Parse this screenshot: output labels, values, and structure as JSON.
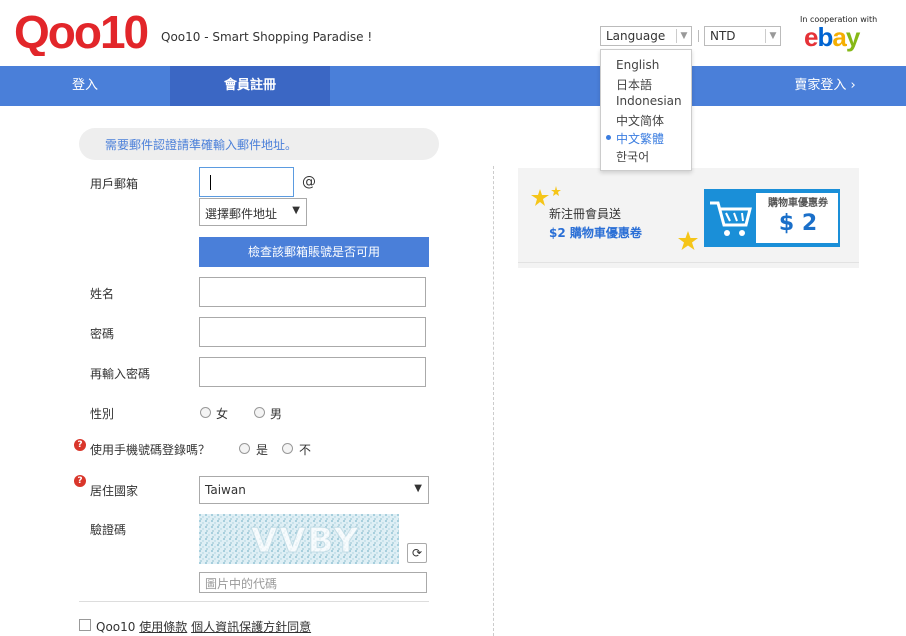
{
  "header": {
    "logo_text": "Qoo10",
    "tagline": "Qoo10 - Smart Shopping Paradise !",
    "language_label": "Language",
    "currency_label": "NTD",
    "coop_label": "In cooperation with",
    "partner_logo": "ebay"
  },
  "nav": {
    "login": "登入",
    "register": "會員註冊",
    "seller_login": "賣家登入 ›"
  },
  "language_menu": {
    "items": [
      "English",
      "日本語",
      "Indonesian",
      "中文简体",
      "中文繁體",
      "한국어"
    ],
    "selected": "中文繁體"
  },
  "notice": "需要郵件認證請準確輸入郵件地址。",
  "form": {
    "email_label": "用戶郵箱",
    "email_value": "",
    "at_sign": "@",
    "domain_select": "選擇郵件地址",
    "check_button": "檢查該郵箱賬號是否可用",
    "name_label": "姓名",
    "password_label": "密碼",
    "password_confirm_label": "再輸入密碼",
    "gender_label": "性別",
    "gender_female": "女",
    "gender_male": "男",
    "mobile_question": "使用手機號碼登錄嗎？",
    "mobile_yes": "是",
    "mobile_no": "不",
    "country_label": "居住國家",
    "country_value": "Taiwan",
    "captcha_label": "驗證碼",
    "captcha_text": "VVBY",
    "captcha_placeholder": "圖片中的代碼",
    "agree_prefix": "Qoo10",
    "agree_terms": "使用條款",
    "agree_privacy": "個人資訊保護方針同意"
  },
  "promo": {
    "line1": "新注冊會員送",
    "line2": "$2 購物車優惠卷",
    "coupon_title": "購物車優惠券",
    "coupon_amount": "$ 2"
  },
  "colors": {
    "brand_red": "#e2262a",
    "nav_blue": "#4a7fd9",
    "nav_active": "#3b67c4",
    "link_blue": "#2a6fd6"
  }
}
